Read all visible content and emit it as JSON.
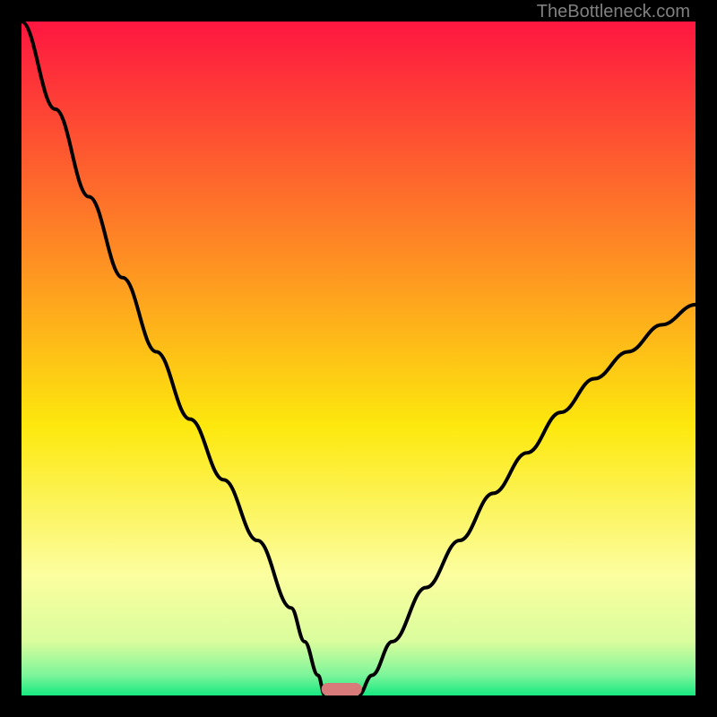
{
  "attribution": "TheBottleneck.com",
  "chart_data": {
    "type": "line",
    "title": "",
    "xlabel": "",
    "ylabel": "",
    "xlim": [
      0,
      100
    ],
    "ylim": [
      0,
      100
    ],
    "series": [
      {
        "name": "left-curve",
        "x": [
          0,
          5,
          10,
          15,
          20,
          25,
          30,
          35,
          40,
          42,
          44,
          45
        ],
        "y": [
          100,
          87,
          74,
          62,
          51,
          41,
          32,
          23,
          13,
          8,
          3,
          0
        ]
      },
      {
        "name": "right-curve",
        "x": [
          50,
          52,
          55,
          60,
          65,
          70,
          75,
          80,
          85,
          90,
          95,
          100
        ],
        "y": [
          0,
          3,
          8,
          16,
          23,
          30,
          36,
          42,
          47,
          51,
          55,
          58
        ]
      }
    ],
    "marker": {
      "x_center": 47.5,
      "width": 6,
      "color": "#d97a7a"
    },
    "gradient_stops": [
      {
        "offset": 0,
        "color": "#fe1640"
      },
      {
        "offset": 35,
        "color": "#fe8e23"
      },
      {
        "offset": 60,
        "color": "#fde80d"
      },
      {
        "offset": 82,
        "color": "#fcfe9f"
      },
      {
        "offset": 92,
        "color": "#dafd9d"
      },
      {
        "offset": 97,
        "color": "#7cf59a"
      },
      {
        "offset": 100,
        "color": "#17e880"
      }
    ]
  }
}
